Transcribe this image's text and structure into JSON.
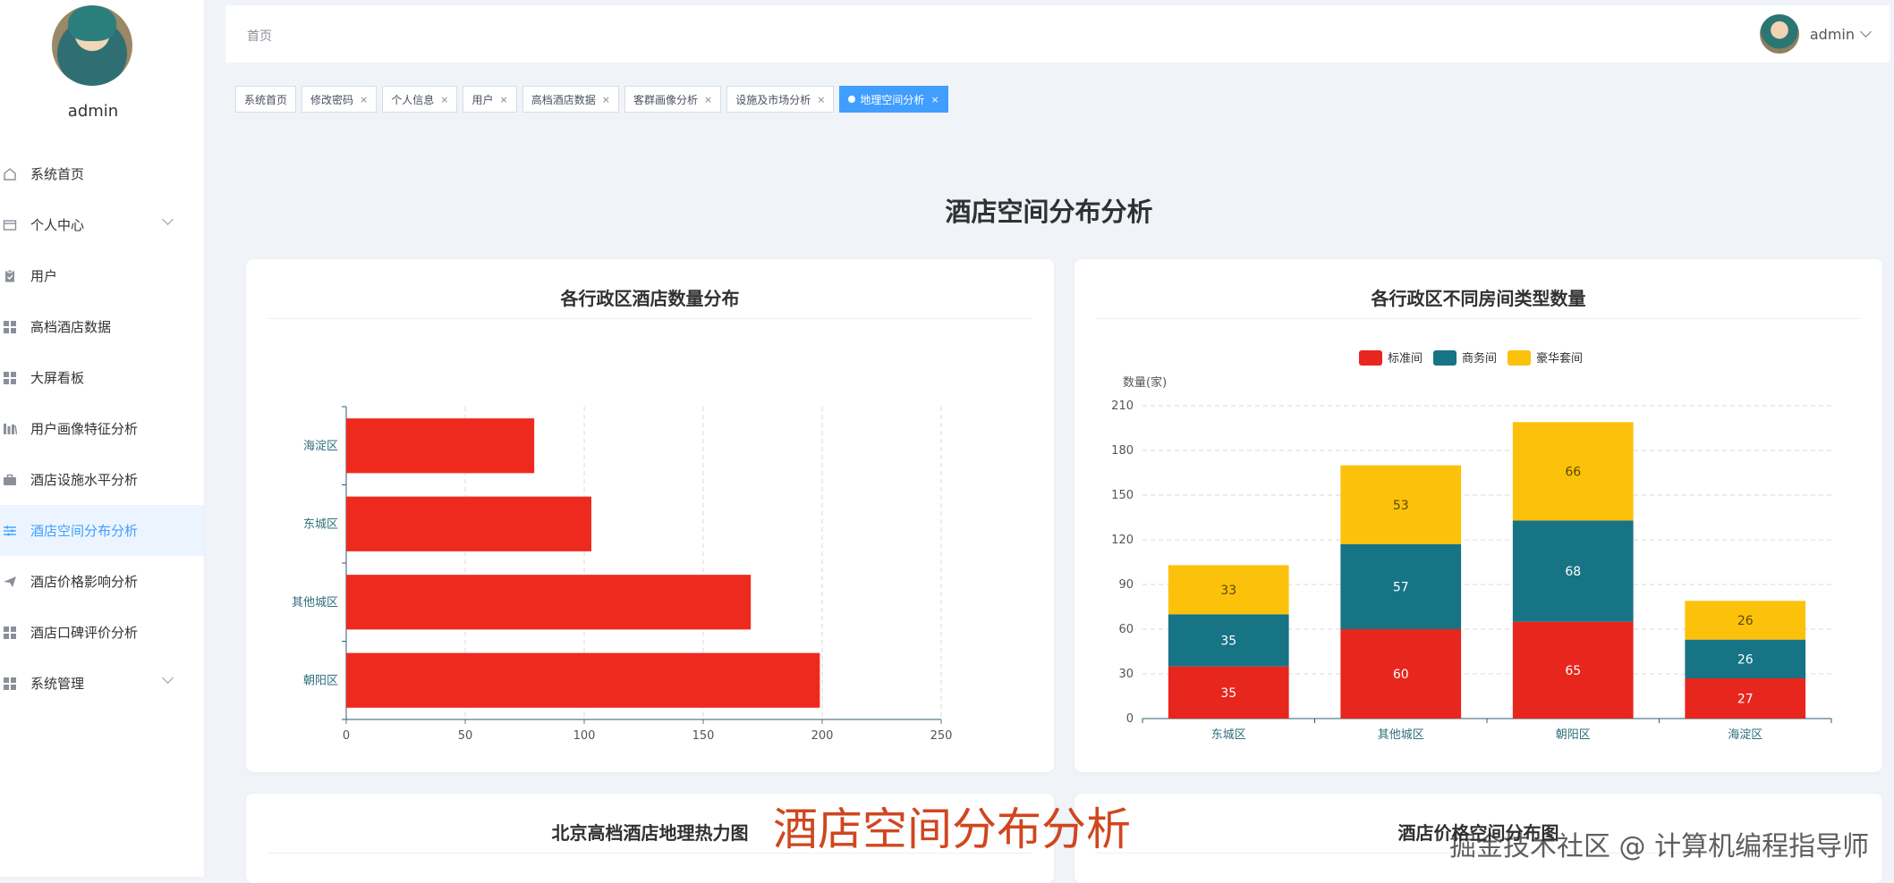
{
  "sidebar": {
    "username": "admin",
    "items": [
      {
        "label": "系统首页",
        "icon": "home-icon"
      },
      {
        "label": "个人中心",
        "icon": "id-card-icon",
        "expandable": true
      },
      {
        "label": "用户",
        "icon": "clipboard-icon"
      },
      {
        "label": "高档酒店数据",
        "icon": "grid-icon"
      },
      {
        "label": "大屏看板",
        "icon": "grid-icon"
      },
      {
        "label": "用户画像特征分析",
        "icon": "bar-chart-icon"
      },
      {
        "label": "酒店设施水平分析",
        "icon": "briefcase-icon"
      },
      {
        "label": "酒店空间分布分析",
        "icon": "sliders-icon",
        "active": true
      },
      {
        "label": "酒店价格影响分析",
        "icon": "send-icon"
      },
      {
        "label": "酒店口碑评价分析",
        "icon": "grid-icon"
      },
      {
        "label": "系统管理",
        "icon": "grid-icon",
        "expandable": true
      }
    ]
  },
  "header": {
    "breadcrumb": "首页",
    "username": "admin"
  },
  "tabs": [
    {
      "label": "系统首页",
      "closable": false
    },
    {
      "label": "修改密码",
      "closable": true
    },
    {
      "label": "个人信息",
      "closable": true
    },
    {
      "label": "用户",
      "closable": true
    },
    {
      "label": "高档酒店数据",
      "closable": true
    },
    {
      "label": "客群画像分析",
      "closable": true
    },
    {
      "label": "设施及市场分析",
      "closable": true
    },
    {
      "label": "地理空间分析",
      "closable": true,
      "active": true
    }
  ],
  "close_glyph": "×",
  "page": {
    "title": "酒店空间分布分析"
  },
  "cards": {
    "bottom_left_title": "北京高档酒店地理热力图",
    "bottom_right_title": "酒店价格空间分布图"
  },
  "chart_data": [
    {
      "type": "bar",
      "orientation": "horizontal",
      "title": "各行政区酒店数量分布",
      "categories": [
        "海淀区",
        "东城区",
        "其他城区",
        "朝阳区"
      ],
      "values": [
        79,
        103,
        170,
        199
      ],
      "xlim": [
        0,
        250
      ],
      "xticks": [
        0,
        50,
        100,
        150,
        200,
        250
      ],
      "grid": "vertical dashed",
      "color": "#ee2a1f"
    },
    {
      "type": "bar",
      "stacked": true,
      "title": "各行政区不同房间类型数量",
      "ylabel": "数量(家)",
      "categories": [
        "东城区",
        "其他城区",
        "朝阳区",
        "海淀区"
      ],
      "series": [
        {
          "name": "标准间",
          "color": "#e7261d",
          "values": [
            35,
            60,
            65,
            27
          ]
        },
        {
          "name": "商务间",
          "color": "#167485",
          "values": [
            35,
            57,
            68,
            26
          ]
        },
        {
          "name": "豪华套间",
          "color": "#fcc10b",
          "values": [
            33,
            53,
            66,
            26
          ]
        }
      ],
      "ylim": [
        0,
        210
      ],
      "yticks": [
        0,
        30,
        60,
        90,
        120,
        150,
        180,
        210
      ],
      "legend": "top",
      "grid": "horizontal dashed"
    }
  ],
  "watermarks": {
    "overlay": "酒店空间分布分析",
    "corner": "掘金技术社区 @ 计算机编程指导师"
  }
}
